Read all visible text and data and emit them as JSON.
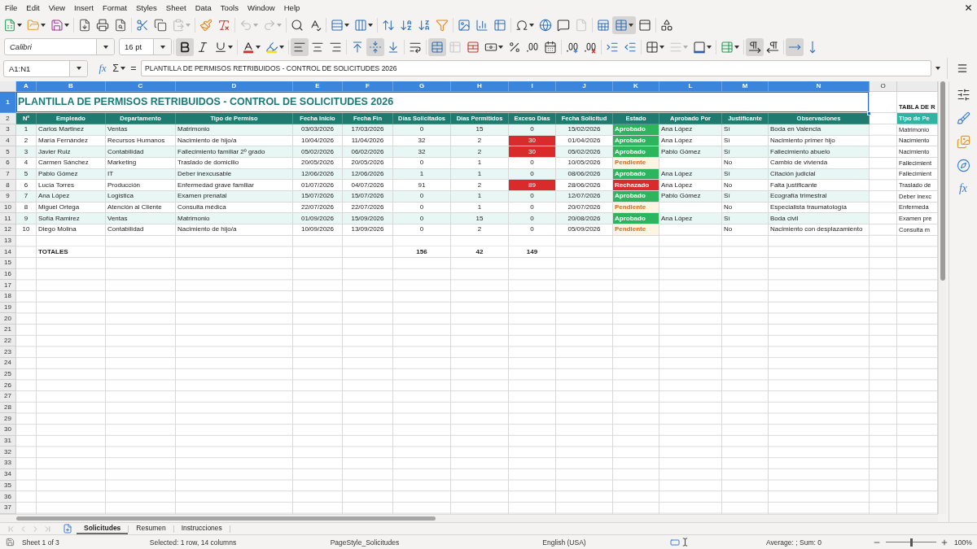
{
  "menu_bar": {
    "items": [
      "File",
      "Edit",
      "View",
      "Insert",
      "Format",
      "Styles",
      "Sheet",
      "Data",
      "Tools",
      "Window",
      "Help"
    ]
  },
  "standard_toolbar": [
    [
      {
        "kind": "new",
        "pressed": false,
        "disabled": false
      },
      {
        "kind": "open",
        "pressed": false,
        "disabled": false
      },
      {
        "kind": "save",
        "pressed": false,
        "disabled": false
      }
    ],
    [
      {
        "kind": "pdf",
        "pressed": false,
        "disabled": false
      },
      {
        "kind": "print",
        "pressed": false,
        "disabled": false
      },
      {
        "kind": "preview",
        "pressed": false,
        "disabled": false
      }
    ],
    [
      {
        "kind": "cut",
        "pressed": false,
        "disabled": false
      },
      {
        "kind": "copy",
        "pressed": false,
        "disabled": false
      },
      {
        "kind": "paste",
        "pressed": false,
        "disabled": true
      }
    ],
    [
      {
        "kind": "clone",
        "pressed": false,
        "disabled": false
      },
      {
        "kind": "clearformat",
        "pressed": false,
        "disabled": false
      }
    ],
    [
      {
        "kind": "undo",
        "pressed": false,
        "disabled": true
      },
      {
        "kind": "redo",
        "pressed": false,
        "disabled": true
      }
    ],
    [
      {
        "kind": "find",
        "pressed": false,
        "disabled": false
      },
      {
        "kind": "spelling",
        "pressed": false,
        "disabled": false
      }
    ],
    [
      {
        "kind": "row",
        "pressed": false,
        "disabled": false
      },
      {
        "kind": "column",
        "pressed": false,
        "disabled": false
      }
    ],
    [
      {
        "kind": "sort",
        "pressed": false,
        "disabled": false
      },
      {
        "kind": "sortasc",
        "pressed": false,
        "disabled": false
      },
      {
        "kind": "sortdesc",
        "pressed": false,
        "disabled": false
      },
      {
        "kind": "autofilter",
        "pressed": false,
        "disabled": false
      }
    ],
    [
      {
        "kind": "image",
        "pressed": false,
        "disabled": false
      },
      {
        "kind": "chart",
        "pressed": false,
        "disabled": false
      },
      {
        "kind": "pivot",
        "pressed": false,
        "disabled": false
      }
    ],
    [
      {
        "kind": "specialchar",
        "pressed": false,
        "disabled": false
      },
      {
        "kind": "hyperlink",
        "pressed": false,
        "disabled": false
      },
      {
        "kind": "comment",
        "pressed": false,
        "disabled": false
      },
      {
        "kind": "headerfooter",
        "pressed": false,
        "disabled": true
      }
    ],
    [
      {
        "kind": "printarea",
        "pressed": false,
        "disabled": false
      },
      {
        "kind": "freeze",
        "pressed": true,
        "disabled": false
      },
      {
        "kind": "split",
        "pressed": false,
        "disabled": false
      }
    ],
    [
      {
        "kind": "shapes",
        "pressed": false,
        "disabled": false
      }
    ]
  ],
  "formatting_toolbar": {
    "font_name": "Calibri",
    "font_size": "16 pt",
    "groups": [
      [
        {
          "kind": "bold",
          "pressed": true,
          "disabled": false
        },
        {
          "kind": "italic",
          "pressed": false,
          "disabled": false
        },
        {
          "kind": "underline",
          "pressed": false,
          "disabled": false
        }
      ],
      [
        {
          "kind": "fontcolor",
          "pressed": false,
          "disabled": false
        },
        {
          "kind": "highlight",
          "pressed": false,
          "disabled": false
        }
      ],
      [
        {
          "kind": "alignleft",
          "pressed": true,
          "disabled": false
        },
        {
          "kind": "aligncenter",
          "pressed": false,
          "disabled": false
        },
        {
          "kind": "alignright",
          "pressed": false,
          "disabled": false
        }
      ],
      [
        {
          "kind": "aligntop",
          "pressed": false,
          "disabled": false
        },
        {
          "kind": "alignmiddle",
          "pressed": true,
          "disabled": false
        },
        {
          "kind": "alignbottom",
          "pressed": false,
          "disabled": false
        }
      ],
      [
        {
          "kind": "wrap",
          "pressed": false,
          "disabled": false
        }
      ],
      [
        {
          "kind": "mergecenter",
          "pressed": true,
          "disabled": false
        },
        {
          "kind": "merge",
          "pressed": false,
          "disabled": true
        },
        {
          "kind": "unmerge",
          "pressed": false,
          "disabled": false
        },
        {
          "kind": "currency",
          "pressed": false,
          "disabled": false
        },
        {
          "kind": "percent",
          "pressed": false,
          "disabled": false
        },
        {
          "kind": "number",
          "pressed": false,
          "disabled": false
        },
        {
          "kind": "date",
          "pressed": false,
          "disabled": false
        }
      ],
      [
        {
          "kind": "adddecimal",
          "pressed": false,
          "disabled": false
        },
        {
          "kind": "deletedecimal",
          "pressed": false,
          "disabled": false
        }
      ],
      [
        {
          "kind": "indent",
          "pressed": false,
          "disabled": false
        },
        {
          "kind": "outdent",
          "pressed": false,
          "disabled": false
        }
      ],
      [
        {
          "kind": "borders",
          "pressed": false,
          "disabled": false
        },
        {
          "kind": "borderstyle",
          "pressed": false,
          "disabled": true
        },
        {
          "kind": "bordercolor",
          "pressed": false,
          "disabled": false
        }
      ],
      [
        {
          "kind": "conditional",
          "pressed": false,
          "disabled": false
        }
      ],
      [
        {
          "kind": "ltr",
          "pressed": true,
          "disabled": false
        },
        {
          "kind": "rtl",
          "pressed": false,
          "disabled": false
        }
      ],
      [
        {
          "kind": "horizontaltext",
          "pressed": true,
          "disabled": false
        },
        {
          "kind": "verticaltext",
          "pressed": false,
          "disabled": false
        }
      ]
    ]
  },
  "formula_bar": {
    "name_box": "A1:N1",
    "function_wizard": "fx",
    "sum": "Σ",
    "equals": "=",
    "content": "PLANTILLA DE PERMISOS RETRIBUIDOS - CONTROL DE SOLICITUDES 2026"
  },
  "sheet": {
    "column_headers": [
      {
        "label": "A",
        "selected": true
      },
      {
        "label": "B",
        "selected": true
      },
      {
        "label": "C",
        "selected": true
      },
      {
        "label": "D",
        "selected": true
      },
      {
        "label": "E",
        "selected": true
      },
      {
        "label": "F",
        "selected": true
      },
      {
        "label": "G",
        "selected": true
      },
      {
        "label": "H",
        "selected": true
      },
      {
        "label": "I",
        "selected": true
      },
      {
        "label": "J",
        "selected": true
      },
      {
        "label": "K",
        "selected": true
      },
      {
        "label": "L",
        "selected": true
      },
      {
        "label": "M",
        "selected": true
      },
      {
        "label": "N",
        "selected": true
      },
      {
        "label": "O",
        "selected": false
      }
    ],
    "row_headers": [
      {
        "label": "1",
        "selected": true
      },
      {
        "label": "2",
        "selected": false
      },
      {
        "label": "3",
        "selected": false
      },
      {
        "label": "4",
        "selected": false
      },
      {
        "label": "5",
        "selected": false
      },
      {
        "label": "6",
        "selected": false
      },
      {
        "label": "7",
        "selected": false
      },
      {
        "label": "8",
        "selected": false
      },
      {
        "label": "9",
        "selected": false
      },
      {
        "label": "10",
        "selected": false
      },
      {
        "label": "11",
        "selected": false
      },
      {
        "label": "12",
        "selected": false
      },
      {
        "label": "13",
        "selected": false
      },
      {
        "label": "14",
        "selected": false
      },
      {
        "label": "15",
        "selected": false
      },
      {
        "label": "16",
        "selected": false
      },
      {
        "label": "17",
        "selected": false
      },
      {
        "label": "18",
        "selected": false
      },
      {
        "label": "19",
        "selected": false
      },
      {
        "label": "20",
        "selected": false
      },
      {
        "label": "21",
        "selected": false
      },
      {
        "label": "22",
        "selected": false
      },
      {
        "label": "23",
        "selected": false
      },
      {
        "label": "24",
        "selected": false
      },
      {
        "label": "25",
        "selected": false
      },
      {
        "label": "26",
        "selected": false
      },
      {
        "label": "27",
        "selected": false
      },
      {
        "label": "28",
        "selected": false
      },
      {
        "label": "29",
        "selected": false
      },
      {
        "label": "30",
        "selected": false
      },
      {
        "label": "31",
        "selected": false
      },
      {
        "label": "32",
        "selected": false
      },
      {
        "label": "33",
        "selected": false
      },
      {
        "label": "34",
        "selected": false
      },
      {
        "label": "35",
        "selected": false
      },
      {
        "label": "36",
        "selected": false
      },
      {
        "label": "37",
        "selected": false
      }
    ],
    "title": "PLANTILLA DE PERMISOS RETRIBUIDOS - CONTROL DE SOLICITUDES 2026",
    "header": [
      "Nº",
      "Empleado",
      "Departamento",
      "Tipo de Permiso",
      "Fecha Inicio",
      "Fecha Fin",
      "Días Solicitados",
      "Días Permitidos",
      "Exceso Días",
      "Fecha Solicitud",
      "Estado",
      "Aprobado Por",
      "Justificante",
      "Observaciones"
    ],
    "rows": [
      {
        "no": "1",
        "employee": "Carlos Martinez",
        "department": "Ventas",
        "leave_type": "Matrimonio",
        "start_date": "03/03/2026",
        "end_date": "17/03/2026",
        "days_requested": "0",
        "days_allowed": "15",
        "excess_days": "0",
        "excess_alert": false,
        "request_date": "15/02/2026",
        "status": {
          "label": "Aprobado",
          "kind": "approved"
        },
        "approved_by": "Ana López",
        "supporting_doc": "Sí",
        "notes": "Boda en Valencia"
      },
      {
        "no": "2",
        "employee": "María Fernández",
        "department": "Recursos Humanos",
        "leave_type": "Nacimiento de hijo/a",
        "start_date": "10/04/2026",
        "end_date": "11/04/2026",
        "days_requested": "32",
        "days_allowed": "2",
        "excess_days": "30",
        "excess_alert": true,
        "request_date": "01/04/2026",
        "status": {
          "label": "Aprobado",
          "kind": "approved"
        },
        "approved_by": "Ana López",
        "supporting_doc": "Sí",
        "notes": "Nacimiento primer hijo"
      },
      {
        "no": "3",
        "employee": "Javier Ruiz",
        "department": "Contabilidad",
        "leave_type": "Fallecimiento familiar 2º grado",
        "start_date": "05/02/2026",
        "end_date": "06/02/2026",
        "days_requested": "32",
        "days_allowed": "2",
        "excess_days": "30",
        "excess_alert": true,
        "request_date": "05/02/2026",
        "status": {
          "label": "Aprobado",
          "kind": "approved"
        },
        "approved_by": "Pablo Gómez",
        "supporting_doc": "Sí",
        "notes": "Fallecimiento abuelo"
      },
      {
        "no": "4",
        "employee": "Carmen Sánchez",
        "department": "Marketing",
        "leave_type": "Traslado de domicilio",
        "start_date": "20/05/2026",
        "end_date": "20/05/2026",
        "days_requested": "0",
        "days_allowed": "1",
        "excess_days": "0",
        "excess_alert": false,
        "request_date": "10/05/2026",
        "status": {
          "label": "Pendiente",
          "kind": "pending"
        },
        "supporting_doc": "No",
        "notes": "Cambio de vivienda"
      },
      {
        "no": "5",
        "employee": "Pablo Gómez",
        "department": "IT",
        "leave_type": "Deber inexcusable",
        "start_date": "12/06/2026",
        "end_date": "12/06/2026",
        "days_requested": "1",
        "days_allowed": "1",
        "excess_days": "0",
        "excess_alert": false,
        "request_date": "08/06/2026",
        "status": {
          "label": "Aprobado",
          "kind": "approved"
        },
        "approved_by": "Ana López",
        "supporting_doc": "Sí",
        "notes": "Citación judicial"
      },
      {
        "no": "6",
        "employee": "Lucía Torres",
        "department": "Producción",
        "leave_type": "Enfermedad grave familiar",
        "start_date": "01/07/2026",
        "end_date": "04/07/2026",
        "days_requested": "91",
        "days_allowed": "2",
        "excess_days": "89",
        "excess_alert": true,
        "request_date": "28/06/2026",
        "status": {
          "label": "Rechazado",
          "kind": "rejected"
        },
        "approved_by": "Ana López",
        "supporting_doc": "No",
        "notes": "Falta justificante"
      },
      {
        "no": "7",
        "employee": "Ana López",
        "department": "Logística",
        "leave_type": "Examen prenatal",
        "start_date": "15/07/2026",
        "end_date": "15/07/2026",
        "days_requested": "0",
        "days_allowed": "1",
        "excess_days": "0",
        "excess_alert": false,
        "request_date": "12/07/2026",
        "status": {
          "label": "Aprobado",
          "kind": "approved"
        },
        "approved_by": "Pablo Gómez",
        "supporting_doc": "Sí",
        "notes": "Ecografía trimestral"
      },
      {
        "no": "8",
        "employee": "Miguel Ortega",
        "department": "Atención al Cliente",
        "leave_type": "Consulta médica",
        "start_date": "22/07/2026",
        "end_date": "22/07/2026",
        "days_requested": "0",
        "days_allowed": "1",
        "excess_days": "0",
        "excess_alert": false,
        "request_date": "20/07/2026",
        "status": {
          "label": "Pendiente",
          "kind": "pending"
        },
        "supporting_doc": "No",
        "notes": "Especialista traumatología"
      },
      {
        "no": "9",
        "employee": "Sofía Ramirez",
        "department": "Ventas",
        "leave_type": "Matrimonio",
        "start_date": "01/09/2026",
        "end_date": "15/09/2026",
        "days_requested": "0",
        "days_allowed": "15",
        "excess_days": "0",
        "excess_alert": false,
        "request_date": "20/08/2026",
        "status": {
          "label": "Aprobado",
          "kind": "approved"
        },
        "approved_by": "Ana López",
        "supporting_doc": "Sí",
        "notes": "Boda civil"
      },
      {
        "no": "10",
        "employee": "Diego Molina",
        "department": "Contabilidad",
        "leave_type": "Nacimiento de hijo/a",
        "start_date": "10/09/2026",
        "end_date": "13/09/2026",
        "days_requested": "0",
        "days_allowed": "2",
        "excess_days": "0",
        "excess_alert": false,
        "request_date": "05/09/2026",
        "status": {
          "label": "Pendiente",
          "kind": "pending"
        },
        "supporting_doc": "No",
        "notes": "Nacimiento con desplazamiento"
      }
    ],
    "totals": {
      "label": "TOTALES",
      "days_requested": "156",
      "days_allowed": "42",
      "excess_days": "149"
    },
    "side_table": {
      "title": "TABLA DE R",
      "header": "Tipo de Pe",
      "items": [
        "Matrimonio",
        "Nacimiento",
        "Nacimiento",
        "Fallecimient",
        "Fallecimient",
        "Traslado de",
        "Deber inexc",
        "Enfermeda",
        "Examen pre",
        "Consulta m"
      ]
    }
  },
  "sidebar": {
    "buttons": [
      {
        "kind": "properties"
      },
      {
        "kind": "styles"
      },
      {
        "kind": "gallery"
      },
      {
        "kind": "navigator"
      },
      {
        "kind": "functions",
        "label": "fx"
      }
    ]
  },
  "sheet_tabs": {
    "nav": [
      {
        "kind": "first",
        "disabled": true
      },
      {
        "kind": "previous",
        "disabled": true
      },
      {
        "kind": "next",
        "disabled": true
      },
      {
        "kind": "last",
        "disabled": true
      }
    ],
    "tabs": [
      {
        "label": "Solicitudes",
        "selected": true
      },
      {
        "label": "Resumen",
        "selected": false
      },
      {
        "label": "Instrucciones",
        "selected": false
      }
    ]
  },
  "status_bar": {
    "sheet": "Sheet 1 of 3",
    "selection": "Selected: 1 row, 14 columns",
    "page_style": "PageStyle_Solicitudes",
    "language": "English (USA)",
    "sum": "Average: ; Sum: 0",
    "zoom": {
      "level": 0.5,
      "reading": "100%"
    }
  }
}
